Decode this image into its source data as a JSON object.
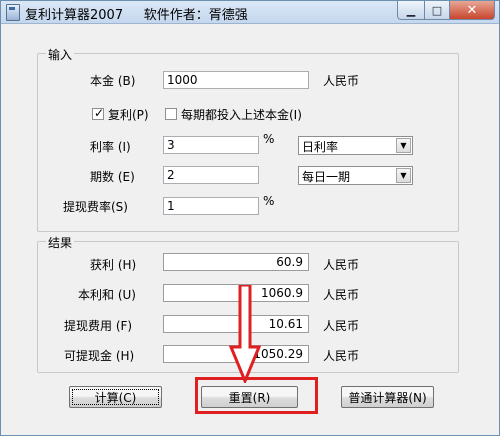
{
  "window": {
    "title": "复利计算器2007     软件作者：胥德强"
  },
  "input": {
    "group_label": "输入",
    "principal_label": "本金 (B)",
    "principal_value": "1000",
    "principal_unit": "人民币",
    "compound_label": "复利(P)",
    "compound_checked": true,
    "deposit_label": "每期都投入上述本金(I)",
    "deposit_checked": false,
    "rate_label": "利率 (I)",
    "rate_value": "3",
    "rate_unit": "%",
    "rate_type": "日利率",
    "periods_label": "期数 (E)",
    "periods_value": "2",
    "period_type": "每日一期",
    "fee_rate_label": "提现费率(S)",
    "fee_rate_value": "1",
    "fee_rate_unit": "%"
  },
  "result": {
    "group_label": "结果",
    "profit_label": "获利 (H)",
    "profit_value": "60.9",
    "profit_unit": "人民币",
    "total_label": "本利和 (U)",
    "total_value": "1060.9",
    "total_unit": "人民币",
    "fee_label": "提现费用 (F)",
    "fee_value": "10.61",
    "fee_unit": "人民币",
    "withdraw_label": "可提现金 (H)",
    "withdraw_value": "1050.29",
    "withdraw_unit": "人民币"
  },
  "buttons": {
    "calculate": "计算(C)",
    "reset": "重置(R)",
    "normal_calc": "普通计算器(N)"
  },
  "colors": {
    "annotation": "#e02020"
  }
}
